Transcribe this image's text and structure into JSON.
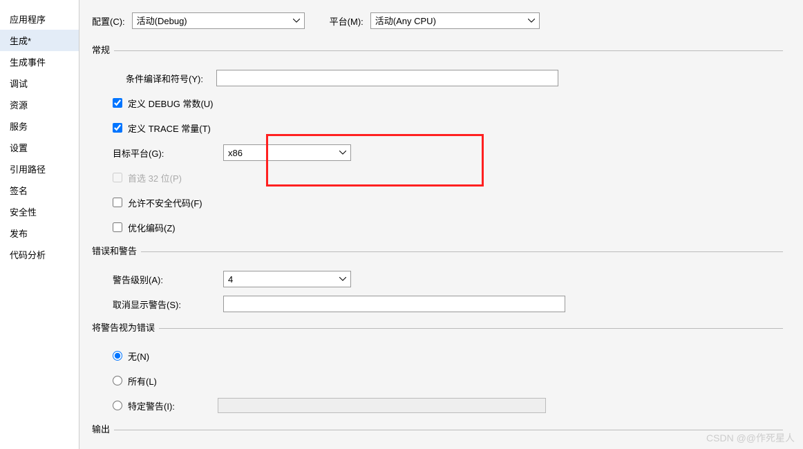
{
  "sidebar": {
    "items": [
      {
        "label": "应用程序"
      },
      {
        "label": "生成*"
      },
      {
        "label": "生成事件"
      },
      {
        "label": "调试"
      },
      {
        "label": "资源"
      },
      {
        "label": "服务"
      },
      {
        "label": "设置"
      },
      {
        "label": "引用路径"
      },
      {
        "label": "签名"
      },
      {
        "label": "安全性"
      },
      {
        "label": "发布"
      },
      {
        "label": "代码分析"
      }
    ]
  },
  "topbar": {
    "config_label": "配置(C):",
    "config_value": "活动(Debug)",
    "platform_label": "平台(M):",
    "platform_value": "活动(Any CPU)"
  },
  "section_general": {
    "title": "常规",
    "symbols_label": "条件编译和符号(Y):",
    "symbols_value": "",
    "define_debug": "定义 DEBUG 常数(U)",
    "define_trace": "定义 TRACE 常量(T)",
    "target_platform_label": "目标平台(G):",
    "target_platform_value": "x86",
    "prefer_32": "首选 32 位(P)",
    "allow_unsafe": "允许不安全代码(F)",
    "optimize": "优化编码(Z)"
  },
  "section_warnings": {
    "title": "错误和警告",
    "level_label": "警告级别(A):",
    "level_value": "4",
    "suppress_label": "取消显示警告(S):",
    "suppress_value": ""
  },
  "section_treat_as_error": {
    "title": "将警告视为错误",
    "none": "无(N)",
    "all": "所有(L)",
    "specific": "特定警告(I):",
    "specific_value": ""
  },
  "section_output": {
    "title": "输出"
  },
  "watermark": "CSDN @@作死星人"
}
